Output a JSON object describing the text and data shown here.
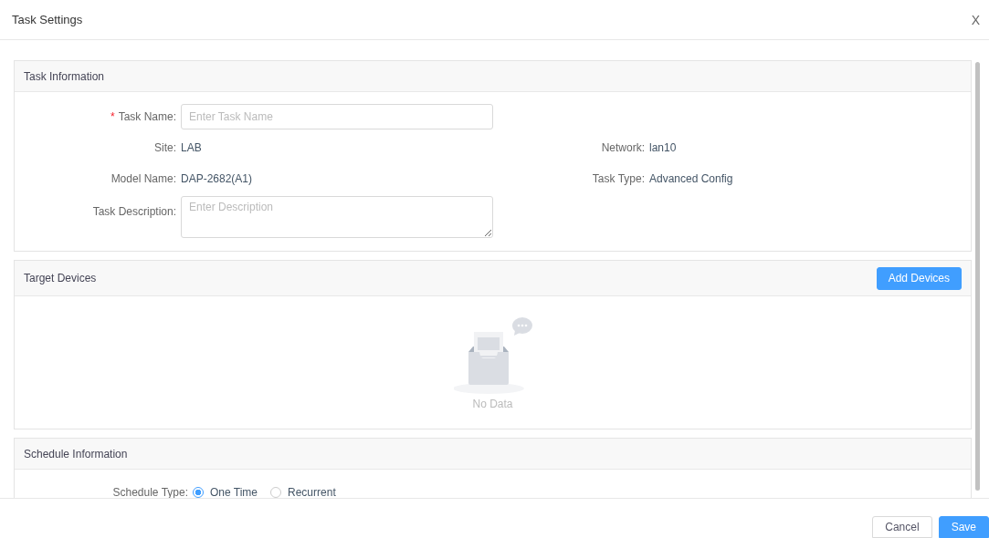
{
  "dialog": {
    "title": "Task Settings",
    "close": "X"
  },
  "task_information": {
    "title": "Task Information",
    "task_name": {
      "required_mark": "*",
      "label": "Task Name:",
      "placeholder": "Enter Task Name"
    },
    "site": {
      "label": "Site:",
      "value": "LAB"
    },
    "network": {
      "label": "Network:",
      "value": "lan10"
    },
    "model_name": {
      "label": "Model Name:",
      "value": "DAP-2682(A1)"
    },
    "task_type": {
      "label": "Task Type:",
      "value": "Advanced Config"
    },
    "task_description": {
      "label": "Task Description:",
      "placeholder": "Enter Description"
    }
  },
  "target_devices": {
    "title": "Target Devices",
    "button": "Add Devices",
    "empty_text": "No Data"
  },
  "schedule_information": {
    "title": "Schedule Information",
    "label": "Schedule Type:",
    "options": [
      {
        "label": "One Time",
        "selected": true
      },
      {
        "label": "Recurrent",
        "selected": false
      }
    ]
  },
  "buttons": {
    "cancel": "Cancel",
    "save": "Save"
  }
}
